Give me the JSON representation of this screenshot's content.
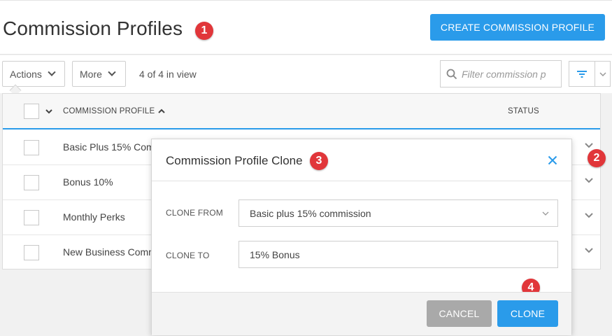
{
  "header": {
    "title": "Commission Profiles",
    "create_button": "CREATE COMMISSION PROFILE"
  },
  "callouts": [
    "1",
    "2",
    "3",
    "4"
  ],
  "toolbar": {
    "actions_label": "Actions",
    "more_label": "More",
    "count_text": "4 of 4 in view",
    "search_placeholder": "Filter commission p"
  },
  "table": {
    "columns": [
      "COMMISSION PROFILE",
      "STATUS"
    ],
    "rows": [
      {
        "name": "Basic Plus 15% Commission"
      },
      {
        "name": "Bonus 10%"
      },
      {
        "name": "Monthly Perks"
      },
      {
        "name": "New Business Commission"
      }
    ]
  },
  "modal": {
    "title": "Commission Profile Clone",
    "clone_from_label": "CLONE FROM",
    "clone_from_value": "Basic plus 15% commission",
    "clone_to_label": "CLONE TO",
    "clone_to_value": "15% Bonus",
    "cancel_label": "CANCEL",
    "clone_label": "CLONE"
  },
  "colors": {
    "accent": "#2a9bea",
    "callout": "#e1363a",
    "cancel": "#a9a9a9"
  }
}
